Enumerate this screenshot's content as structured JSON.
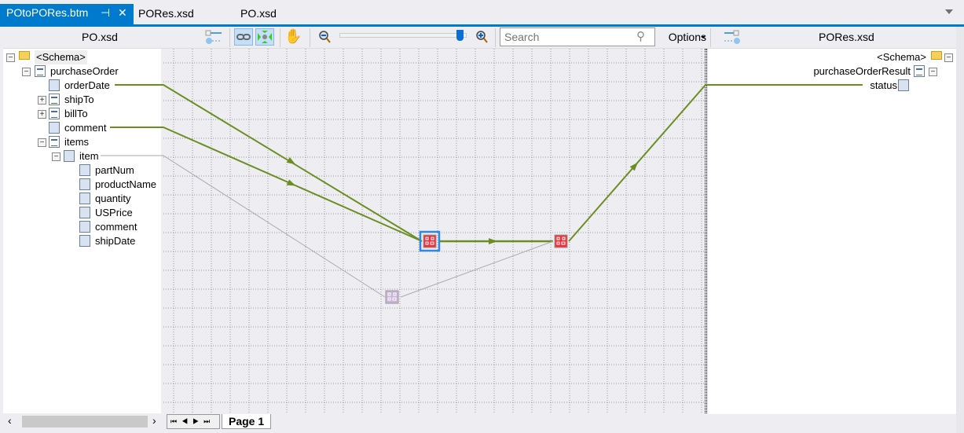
{
  "tabs": [
    {
      "label": "POtoPORes.btm",
      "active": true
    },
    {
      "label": "PORes.xsd"
    },
    {
      "label": "PO.xsd"
    }
  ],
  "toolbar": {
    "source_title": "PO.xsd",
    "target_title": "PORes.xsd",
    "search_placeholder": "Search",
    "options_label": "Options",
    "zoom_level_fraction": 0.95
  },
  "source_tree": [
    {
      "label": "<Schema>",
      "icon": "folder-icon",
      "expander": "minus"
    },
    {
      "label": "purchaseOrder",
      "icon": "record-icon",
      "expander": "minus"
    },
    {
      "label": "orderDate",
      "icon": "linked-field-icon",
      "linked": true
    },
    {
      "label": "shipTo",
      "icon": "record-icon",
      "expander": "plus"
    },
    {
      "label": "billTo",
      "icon": "record-icon",
      "expander": "plus"
    },
    {
      "label": "comment",
      "icon": "linked-field-icon",
      "linked": true
    },
    {
      "label": "items",
      "icon": "record-icon",
      "expander": "minus"
    },
    {
      "label": "item",
      "icon": "linked-record-icon",
      "expander": "minus",
      "linked": true
    },
    {
      "label": "partNum",
      "icon": "attribute-icon"
    },
    {
      "label": "productName",
      "icon": "element-icon"
    },
    {
      "label": "quantity",
      "icon": "element-icon"
    },
    {
      "label": "USPrice",
      "icon": "element-icon"
    },
    {
      "label": "comment",
      "icon": "element-icon"
    },
    {
      "label": "shipDate",
      "icon": "element-icon"
    }
  ],
  "target_tree": [
    {
      "label": "<Schema>",
      "icon": "folder-icon"
    },
    {
      "label": "purchaseOrderResult",
      "icon": "record-icon"
    },
    {
      "label": "status",
      "icon": "linked-field-icon"
    }
  ],
  "pages": {
    "current": "Page 1"
  },
  "colors": {
    "link": "#6b8e23",
    "link_inactive": "#aaaaaa",
    "accent": "#007acc",
    "functoid": "#e8323c",
    "looping_functoid": "#c8b4d8"
  }
}
